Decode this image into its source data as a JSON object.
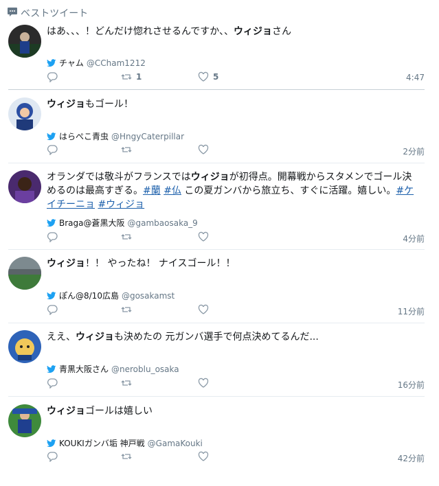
{
  "header": {
    "title": "ベストツイート"
  },
  "tweets": [
    {
      "text_parts": [
        {
          "t": "はあ、、、！どんだけ惚れさせるんですか、、"
        },
        {
          "t": "ウィジョ",
          "b": true
        },
        {
          "t": "さん"
        }
      ],
      "display_name": "チャム",
      "handle": "@CCham1212",
      "retweets": "1",
      "likes": "5",
      "time": "4:47"
    },
    {
      "text_parts": [
        {
          "t": "ウィジョ",
          "b": true
        },
        {
          "t": "もゴール！"
        }
      ],
      "display_name": "はらぺこ青虫",
      "handle": "@HngyCaterpillar",
      "retweets": "",
      "likes": "",
      "time": "2分前"
    },
    {
      "text_parts": [
        {
          "t": "オランダでは敬斗がフランスでは"
        },
        {
          "t": "ウィジョ",
          "b": true
        },
        {
          "t": "が初得点。開幕戦からスタメンでゴール決めるのは最高すぎる。"
        },
        {
          "t": "#蘭",
          "link": true
        },
        {
          "t": " "
        },
        {
          "t": "#仏",
          "link": true
        },
        {
          "t": " この夏ガンバから旅立ち、すぐに活躍。嬉しい。"
        },
        {
          "t": "#ケイチーニョ",
          "link": true
        },
        {
          "t": " "
        },
        {
          "t": "#ウィジョ",
          "link": true
        }
      ],
      "display_name": "Braga@蒼黒大阪",
      "handle": "@gambaosaka_9",
      "retweets": "",
      "likes": "",
      "time": "4分前"
    },
    {
      "text_parts": [
        {
          "t": "ウィジョ",
          "b": true
        },
        {
          "t": "！！ やったね！ ナイスゴール！！"
        }
      ],
      "display_name": "ぽん@8/10広島",
      "handle": "@gosakamst",
      "retweets": "",
      "likes": "",
      "time": "11分前"
    },
    {
      "text_parts": [
        {
          "t": "ええ、"
        },
        {
          "t": "ウィジョ",
          "b": true
        },
        {
          "t": "も決めたの 元ガンバ選手で何点決めてるんだ..."
        }
      ],
      "display_name": "青黒大阪さん",
      "handle": "@neroblu_osaka",
      "retweets": "",
      "likes": "",
      "time": "16分前"
    },
    {
      "text_parts": [
        {
          "t": "ウィジョ",
          "b": true
        },
        {
          "t": "ゴールは嬉しい"
        }
      ],
      "display_name": "KOUKIガンバ垢 神戸戦",
      "handle": "@GamaKouki",
      "retweets": "",
      "likes": "",
      "time": "42分前"
    }
  ]
}
